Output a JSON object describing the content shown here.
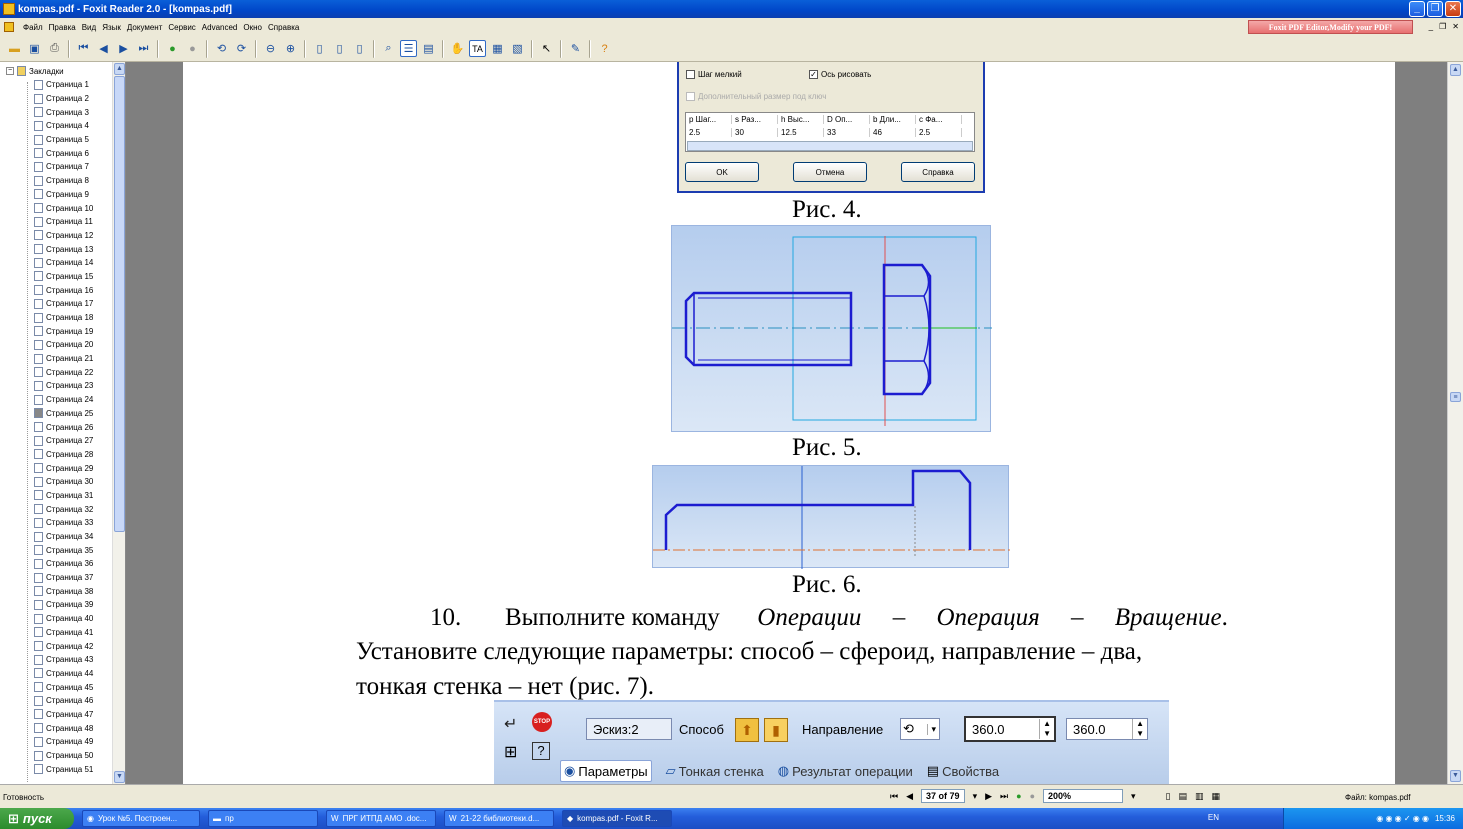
{
  "window": {
    "title": "kompas.pdf - Foxit Reader 2.0 - [kompas.pdf]"
  },
  "menu": [
    "Файл",
    "Правка",
    "Вид",
    "Язык",
    "Документ",
    "Сервис",
    "Advanced",
    "Окно",
    "Справка"
  ],
  "promo": "Foxit PDF Editor,Modify your PDF!",
  "sidebar": {
    "root": "Закладки",
    "pages": [
      "Страница 1",
      "Страница 2",
      "Страница 3",
      "Страница 4",
      "Страница 5",
      "Страница 6",
      "Страница 7",
      "Страница 8",
      "Страница 9",
      "Страница 10",
      "Страница 11",
      "Страница 12",
      "Страница 13",
      "Страница 14",
      "Страница 15",
      "Страница 16",
      "Страница 17",
      "Страница 18",
      "Страница 19",
      "Страница 20",
      "Страница 21",
      "Страница 22",
      "Страница 23",
      "Страница 24",
      "Страница 25",
      "Страница 26",
      "Страница 27",
      "Страница 28",
      "Страница 29",
      "Страница 30",
      "Страница 31",
      "Страница 32",
      "Страница 33",
      "Страница 34",
      "Страница 35",
      "Страница 36",
      "Страница 37",
      "Страница 38",
      "Страница 39",
      "Страница 40",
      "Страница 41",
      "Страница 42",
      "Страница 43",
      "Страница 44",
      "Страница 45",
      "Страница 46",
      "Страница 47",
      "Страница 48",
      "Страница 49",
      "Страница 50",
      "Страница 51"
    ],
    "selected": "Страница 25"
  },
  "dialog": {
    "cb_small_step": "Шаг мелкий",
    "cb_draw_axis": "Ось рисовать",
    "cb_extra_size": "Дополнительный размер под ключ",
    "headers": [
      "p Шаг...",
      "s Раз...",
      "h Выс...",
      "D Оп...",
      "b Дли...",
      "c Фа..."
    ],
    "values": [
      "2.5",
      "30",
      "12.5",
      "33",
      "46",
      "2.5"
    ],
    "btn_ok": "OK",
    "btn_cancel": "Отмена",
    "btn_help": "Справка"
  },
  "captions": {
    "fig4": "Рис. 4.",
    "fig5": "Рис. 5.",
    "fig6": "Рис. 6."
  },
  "paragraph": {
    "n": "10.",
    "t1": "Выполните команду",
    "op1": "Операции",
    "dash": "–",
    "op2": "Операция",
    "op3": "Вращение",
    "dot": ".",
    "line2": "Установите следующие параметры: способ – сфероид, направление – два,",
    "line3": "тонкая стенка – нет (рис. 7)."
  },
  "kompas": {
    "sketch": "Эскиз:2",
    "method": "Способ",
    "direction": "Направление",
    "angle1": "360.0",
    "angle2": "360.0",
    "tab_params": "Параметры",
    "tab_thin": "Тонкая стенка",
    "tab_result": "Результат операции",
    "tab_props": "Свойства"
  },
  "status": {
    "ready": "Готовность",
    "page_of": "37 of 79",
    "zoom": "200%",
    "file": "Файл: kompas.pdf"
  },
  "taskbar": {
    "start": "пуск",
    "tasks": [
      "Урок №5. Построен...",
      "пр",
      "ПРГ ИТПД АМО .doc...",
      "21-22 библиотеки.d...",
      "kompas.pdf - Foxit R..."
    ],
    "lang": "EN",
    "clock": "15:36"
  }
}
